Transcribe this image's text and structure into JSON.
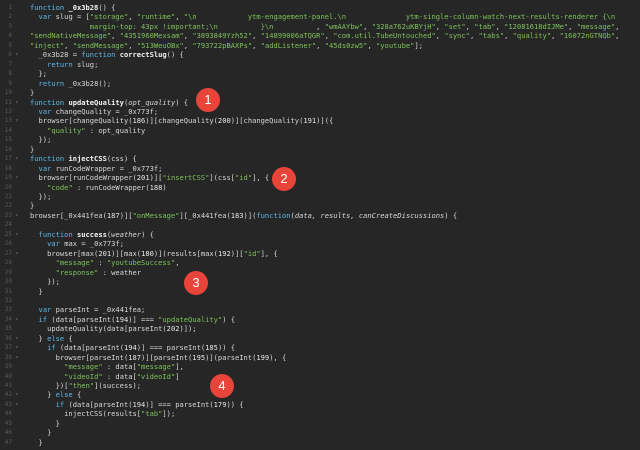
{
  "code_lines": [
    {
      "n": "1",
      "fold": "",
      "segs": [
        [
          "kw",
          "function "
        ],
        [
          "fn",
          "_0x3b28"
        ],
        [
          "pl",
          "() {"
        ]
      ]
    },
    {
      "n": "2",
      "fold": "",
      "segs": [
        [
          "pl",
          "  "
        ],
        [
          "kw",
          "var "
        ],
        [
          "pl",
          "slug = ["
        ],
        [
          "str",
          "\"storage\""
        ],
        [
          "pl",
          ", "
        ],
        [
          "str",
          "\"runtime\""
        ],
        [
          "pl",
          ", "
        ],
        [
          "str",
          "\"\\n            ytm-engagement-panel.\\n              ytm-single-column-watch-next-results-renderer {\\n"
        ]
      ]
    },
    {
      "n": "3",
      "fold": "",
      "segs": [
        [
          "str",
          "              margin-top: 43px !important;\\n          }\\n          "
        ],
        [
          "pl",
          ", "
        ],
        [
          "str",
          "\"wmAAYbw\""
        ],
        [
          "pl",
          ", "
        ],
        [
          "str",
          "\"328a762uKBYjH\""
        ],
        [
          "pl",
          ", "
        ],
        [
          "str",
          "\"set\""
        ],
        [
          "pl",
          ", "
        ],
        [
          "str",
          "\"tab\""
        ],
        [
          "pl",
          ", "
        ],
        [
          "str",
          "\"12081618dIJMe\""
        ],
        [
          "pl",
          ", "
        ],
        [
          "str",
          "\"message\""
        ],
        [
          "pl",
          ","
        ]
      ]
    },
    {
      "n": "4",
      "fold": "",
      "segs": [
        [
          "str",
          "\"sendNativeMessage\""
        ],
        [
          "pl",
          ", "
        ],
        [
          "str",
          "\"4351960Mexsam\""
        ],
        [
          "pl",
          ", "
        ],
        [
          "str",
          "\"3893849Yzh52\""
        ],
        [
          "pl",
          ", "
        ],
        [
          "str",
          "\"14899006aTQGR\""
        ],
        [
          "pl",
          ", "
        ],
        [
          "str",
          "\"com.util.TubeUntouched\""
        ],
        [
          "pl",
          ", "
        ],
        [
          "str",
          "\"sync\""
        ],
        [
          "pl",
          ", "
        ],
        [
          "str",
          "\"tabs\""
        ],
        [
          "pl",
          ", "
        ],
        [
          "str",
          "\"quality\""
        ],
        [
          "pl",
          ", "
        ],
        [
          "str",
          "\"16072nGTNQb\""
        ],
        [
          "pl",
          ","
        ]
      ]
    },
    {
      "n": "5",
      "fold": "",
      "segs": [
        [
          "str",
          "\"inject\""
        ],
        [
          "pl",
          ", "
        ],
        [
          "str",
          "\"sendMessage\""
        ],
        [
          "pl",
          ", "
        ],
        [
          "str",
          "\"513WeuOBx\""
        ],
        [
          "pl",
          ", "
        ],
        [
          "str",
          "\"793722pBAXPs\""
        ],
        [
          "pl",
          ", "
        ],
        [
          "str",
          "\"addListener\""
        ],
        [
          "pl",
          ", "
        ],
        [
          "str",
          "\"45ds0zw5\""
        ],
        [
          "pl",
          ", "
        ],
        [
          "str",
          "\"youtube\""
        ],
        [
          "pl",
          "];"
        ]
      ]
    },
    {
      "n": "6",
      "fold": "▾",
      "segs": [
        [
          "pl",
          "  _0x3b28 = "
        ],
        [
          "kw",
          "function "
        ],
        [
          "fn",
          "correctSlug"
        ],
        [
          "pl",
          "() {"
        ]
      ]
    },
    {
      "n": "7",
      "fold": "",
      "segs": [
        [
          "pl",
          "    "
        ],
        [
          "kw",
          "return "
        ],
        [
          "pl",
          "slug;"
        ]
      ]
    },
    {
      "n": "8",
      "fold": "",
      "segs": [
        [
          "pl",
          "  };"
        ]
      ]
    },
    {
      "n": "9",
      "fold": "",
      "segs": [
        [
          "pl",
          "  "
        ],
        [
          "kw",
          "return "
        ],
        [
          "pl",
          "_0x3b28();"
        ]
      ]
    },
    {
      "n": "10",
      "fold": "",
      "segs": [
        [
          "pl",
          "}"
        ]
      ]
    },
    {
      "n": "11",
      "fold": "▾",
      "segs": [
        [
          "kw",
          "function "
        ],
        [
          "fn",
          "updateQuality"
        ],
        [
          "pl",
          "("
        ],
        [
          "it",
          "opt_quality"
        ],
        [
          "pl",
          ") {"
        ]
      ]
    },
    {
      "n": "12",
      "fold": "",
      "segs": [
        [
          "pl",
          "  "
        ],
        [
          "kw",
          "var "
        ],
        [
          "pl",
          "changeQuality = _0x773f;"
        ]
      ]
    },
    {
      "n": "13",
      "fold": "▾",
      "segs": [
        [
          "pl",
          "  browser[changeQuality("
        ],
        [
          "num",
          "186"
        ],
        [
          "pl",
          ")][changeQuality("
        ],
        [
          "num",
          "200"
        ],
        [
          "pl",
          ")][changeQuality("
        ],
        [
          "num",
          "191"
        ],
        [
          "pl",
          ")]({"
        ]
      ]
    },
    {
      "n": "14",
      "fold": "",
      "segs": [
        [
          "pl",
          "    "
        ],
        [
          "str",
          "\"quality\""
        ],
        [
          "pl",
          " : opt_quality"
        ]
      ]
    },
    {
      "n": "15",
      "fold": "",
      "segs": [
        [
          "pl",
          "  });"
        ]
      ]
    },
    {
      "n": "16",
      "fold": "",
      "segs": [
        [
          "pl",
          "}"
        ]
      ]
    },
    {
      "n": "17",
      "fold": "▾",
      "segs": [
        [
          "kw",
          "function "
        ],
        [
          "fn",
          "injectCSS"
        ],
        [
          "pl",
          "(css) {"
        ]
      ]
    },
    {
      "n": "18",
      "fold": "",
      "segs": [
        [
          "pl",
          "  "
        ],
        [
          "kw",
          "var "
        ],
        [
          "pl",
          "runCodeWrapper = _0x773f;"
        ]
      ]
    },
    {
      "n": "19",
      "fold": "▾",
      "segs": [
        [
          "pl",
          "  browser[runCodeWrapper("
        ],
        [
          "num",
          "201"
        ],
        [
          "pl",
          ")]["
        ],
        [
          "str",
          "\"insertCSS\""
        ],
        [
          "pl",
          "](css["
        ],
        [
          "str",
          "\"id\""
        ],
        [
          "pl",
          "], {"
        ]
      ]
    },
    {
      "n": "20",
      "fold": "",
      "segs": [
        [
          "pl",
          "    "
        ],
        [
          "str",
          "\"code\""
        ],
        [
          "pl",
          " : runCodeWrapper("
        ],
        [
          "num",
          "188"
        ],
        [
          "pl",
          ")"
        ]
      ]
    },
    {
      "n": "21",
      "fold": "",
      "segs": [
        [
          "pl",
          "  });"
        ]
      ]
    },
    {
      "n": "22",
      "fold": "",
      "segs": [
        [
          "pl",
          "}"
        ]
      ]
    },
    {
      "n": "23",
      "fold": "▾",
      "segs": [
        [
          "pl",
          "browser[_0x441fea("
        ],
        [
          "num",
          "187"
        ],
        [
          "pl",
          ")]["
        ],
        [
          "str",
          "\"onMessage\""
        ],
        [
          "pl",
          "][_0x441fea("
        ],
        [
          "num",
          "183"
        ],
        [
          "pl",
          ")]("
        ],
        [
          "kw",
          "function"
        ],
        [
          "pl",
          "("
        ],
        [
          "it",
          "data, results, canCreateDiscussions"
        ],
        [
          "pl",
          ") {"
        ]
      ]
    },
    {
      "n": "24",
      "fold": "",
      "segs": [
        [
          "pl",
          ""
        ]
      ]
    },
    {
      "n": "25",
      "fold": "▾",
      "segs": [
        [
          "pl",
          "  "
        ],
        [
          "kw",
          "function "
        ],
        [
          "fn",
          "success"
        ],
        [
          "pl",
          "("
        ],
        [
          "it",
          "weather"
        ],
        [
          "pl",
          ") {"
        ]
      ]
    },
    {
      "n": "26",
      "fold": "",
      "segs": [
        [
          "pl",
          "    "
        ],
        [
          "kw",
          "var "
        ],
        [
          "pl",
          "max = _0x773f;"
        ]
      ]
    },
    {
      "n": "27",
      "fold": "▾",
      "segs": [
        [
          "pl",
          "    browser[max("
        ],
        [
          "num",
          "201"
        ],
        [
          "pl",
          ")][max("
        ],
        [
          "num",
          "180"
        ],
        [
          "pl",
          ")](results[max("
        ],
        [
          "num",
          "192"
        ],
        [
          "pl",
          ")]["
        ],
        [
          "str",
          "\"id\""
        ],
        [
          "pl",
          "], {"
        ]
      ]
    },
    {
      "n": "28",
      "fold": "",
      "segs": [
        [
          "pl",
          "      "
        ],
        [
          "str",
          "\"message\""
        ],
        [
          "pl",
          " : "
        ],
        [
          "str",
          "\"youtubeSuccess\""
        ],
        [
          "pl",
          ","
        ]
      ]
    },
    {
      "n": "29",
      "fold": "",
      "segs": [
        [
          "pl",
          "      "
        ],
        [
          "str",
          "\"response\""
        ],
        [
          "pl",
          " : weather"
        ]
      ]
    },
    {
      "n": "30",
      "fold": "",
      "segs": [
        [
          "pl",
          "    });"
        ]
      ]
    },
    {
      "n": "31",
      "fold": "",
      "segs": [
        [
          "pl",
          "  }"
        ]
      ]
    },
    {
      "n": "32",
      "fold": "",
      "segs": [
        [
          "pl",
          ""
        ]
      ]
    },
    {
      "n": "33",
      "fold": "",
      "segs": [
        [
          "pl",
          "  "
        ],
        [
          "kw",
          "var "
        ],
        [
          "pl",
          "parseInt = _0x441fea;"
        ]
      ]
    },
    {
      "n": "34",
      "fold": "▾",
      "segs": [
        [
          "pl",
          "  "
        ],
        [
          "kw",
          "if "
        ],
        [
          "pl",
          "(data[parseInt("
        ],
        [
          "num",
          "194"
        ],
        [
          "pl",
          ")] === "
        ],
        [
          "str",
          "\"updateQuality\""
        ],
        [
          "pl",
          ") {"
        ]
      ]
    },
    {
      "n": "35",
      "fold": "",
      "segs": [
        [
          "pl",
          "    updateQuality(data[parseInt("
        ],
        [
          "num",
          "202"
        ],
        [
          "pl",
          ")]);"
        ]
      ]
    },
    {
      "n": "36",
      "fold": "▾",
      "segs": [
        [
          "pl",
          "  } "
        ],
        [
          "kw",
          "else "
        ],
        [
          "pl",
          "{"
        ]
      ]
    },
    {
      "n": "37",
      "fold": "▾",
      "segs": [
        [
          "pl",
          "    "
        ],
        [
          "kw",
          "if "
        ],
        [
          "pl",
          "(data[parseInt("
        ],
        [
          "num",
          "194"
        ],
        [
          "pl",
          ")] === parseInt("
        ],
        [
          "num",
          "185"
        ],
        [
          "pl",
          ")) {"
        ]
      ]
    },
    {
      "n": "38",
      "fold": "▾",
      "segs": [
        [
          "pl",
          "      browser[parseInt("
        ],
        [
          "num",
          "187"
        ],
        [
          "pl",
          ")][parseInt("
        ],
        [
          "num",
          "195"
        ],
        [
          "pl",
          ")](parseInt("
        ],
        [
          "num",
          "199"
        ],
        [
          "pl",
          "), {"
        ]
      ]
    },
    {
      "n": "39",
      "fold": "",
      "segs": [
        [
          "pl",
          "        "
        ],
        [
          "str",
          "\"message\""
        ],
        [
          "pl",
          " : data["
        ],
        [
          "str",
          "\"message\""
        ],
        [
          "pl",
          "],"
        ]
      ]
    },
    {
      "n": "40",
      "fold": "",
      "segs": [
        [
          "pl",
          "        "
        ],
        [
          "str",
          "\"videoId\""
        ],
        [
          "pl",
          " : data["
        ],
        [
          "str",
          "\"videoId\""
        ],
        [
          "pl",
          "]"
        ]
      ]
    },
    {
      "n": "41",
      "fold": "",
      "segs": [
        [
          "pl",
          "      })["
        ],
        [
          "str",
          "\"then\""
        ],
        [
          "pl",
          "](success);"
        ]
      ]
    },
    {
      "n": "42",
      "fold": "▾",
      "segs": [
        [
          "pl",
          "    } "
        ],
        [
          "kw",
          "else "
        ],
        [
          "pl",
          "{"
        ]
      ]
    },
    {
      "n": "43",
      "fold": "▾",
      "segs": [
        [
          "pl",
          "      "
        ],
        [
          "kw",
          "if "
        ],
        [
          "pl",
          "(data[parseInt("
        ],
        [
          "num",
          "194"
        ],
        [
          "pl",
          ")] === parseInt("
        ],
        [
          "num",
          "179"
        ],
        [
          "pl",
          ")) {"
        ]
      ]
    },
    {
      "n": "44",
      "fold": "",
      "segs": [
        [
          "pl",
          "        injectCSS(results["
        ],
        [
          "str",
          "\"tab\""
        ],
        [
          "pl",
          "]);"
        ]
      ]
    },
    {
      "n": "45",
      "fold": "",
      "segs": [
        [
          "pl",
          "      }"
        ]
      ]
    },
    {
      "n": "46",
      "fold": "",
      "segs": [
        [
          "pl",
          "    }"
        ]
      ]
    },
    {
      "n": "47",
      "fold": "",
      "segs": [
        [
          "pl",
          "  }"
        ]
      ]
    }
  ],
  "annotations": [
    {
      "label": "1",
      "name": "annotation-badge-1"
    },
    {
      "label": "2",
      "name": "annotation-badge-2"
    },
    {
      "label": "3",
      "name": "annotation-badge-3"
    },
    {
      "label": "4",
      "name": "annotation-badge-4"
    }
  ]
}
